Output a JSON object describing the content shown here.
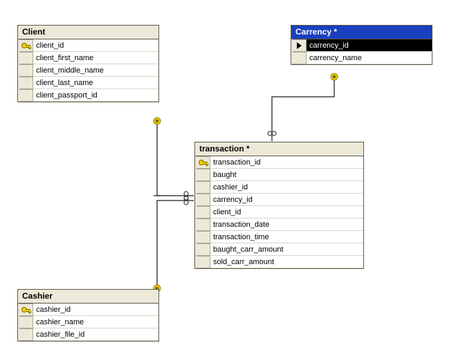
{
  "tables": {
    "client": {
      "title": "Client",
      "fields": [
        {
          "name": "client_id",
          "pk": true
        },
        {
          "name": "client_first_name",
          "pk": false
        },
        {
          "name": "client_middle_name",
          "pk": false
        },
        {
          "name": "client_last_name",
          "pk": false
        },
        {
          "name": "client_passport_id",
          "pk": false
        }
      ]
    },
    "cashier": {
      "title": "Cashier",
      "fields": [
        {
          "name": "cashier_id",
          "pk": true
        },
        {
          "name": "cashier_name",
          "pk": false
        },
        {
          "name": "cashier_file_id",
          "pk": false
        }
      ]
    },
    "transaction": {
      "title": "transaction *",
      "fields": [
        {
          "name": "transaction_id",
          "pk": true
        },
        {
          "name": "baught",
          "pk": false
        },
        {
          "name": "cashier_id",
          "pk": false
        },
        {
          "name": "carrency_id",
          "pk": false
        },
        {
          "name": "client_id",
          "pk": false
        },
        {
          "name": "transaction_date",
          "pk": false
        },
        {
          "name": "transaction_time",
          "pk": false
        },
        {
          "name": "baught_carr_amount",
          "pk": false
        },
        {
          "name": "sold_carr_amount",
          "pk": false
        }
      ]
    },
    "carrency": {
      "title": "Carrency *",
      "selected": true,
      "fields": [
        {
          "name": "carrency_id",
          "pk": true,
          "current": true
        },
        {
          "name": "carrency_name",
          "pk": false
        }
      ]
    }
  },
  "relationships": [
    {
      "from_table": "client",
      "from_side": "one",
      "to_table": "transaction",
      "to_side": "many"
    },
    {
      "from_table": "cashier",
      "from_side": "one",
      "to_table": "transaction",
      "to_side": "many"
    },
    {
      "from_table": "carrency",
      "from_side": "one",
      "to_table": "transaction",
      "to_side": "many"
    }
  ]
}
